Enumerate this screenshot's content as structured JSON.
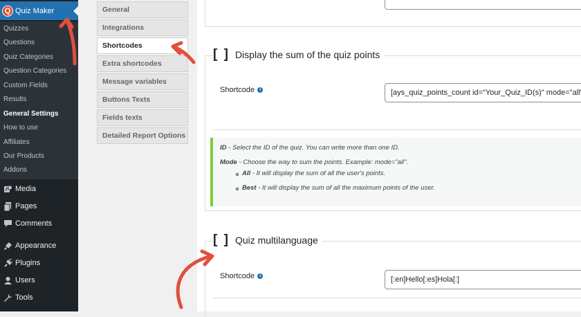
{
  "sidebar": {
    "plugin": {
      "label": "Quiz Maker",
      "icon": "quiz-maker-logo-icon"
    },
    "submenu": [
      {
        "label": "Quizzes"
      },
      {
        "label": "Questions"
      },
      {
        "label": "Quiz Categories"
      },
      {
        "label": "Question Categories"
      },
      {
        "label": "Custom Fields"
      },
      {
        "label": "Results"
      },
      {
        "label": "General Settings",
        "active": true
      },
      {
        "label": "How to use"
      },
      {
        "label": "Affiliates"
      },
      {
        "label": "Our Products"
      },
      {
        "label": "Addons"
      }
    ],
    "menu": [
      {
        "label": "Media",
        "icon": "media-icon"
      },
      {
        "label": "Pages",
        "icon": "pages-icon"
      },
      {
        "label": "Comments",
        "icon": "comments-icon"
      },
      {
        "label": "Appearance",
        "icon": "appearance-icon"
      },
      {
        "label": "Plugins",
        "icon": "plugins-icon"
      },
      {
        "label": "Users",
        "icon": "users-icon"
      },
      {
        "label": "Tools",
        "icon": "tools-icon"
      }
    ]
  },
  "tabs": [
    {
      "label": "General"
    },
    {
      "label": "Integrations"
    },
    {
      "label": "Shortcodes",
      "active": true
    },
    {
      "label": "Extra shortcodes"
    },
    {
      "label": "Message variables"
    },
    {
      "label": "Buttons Texts"
    },
    {
      "label": "Fields texts"
    },
    {
      "label": "Detailed Report Options"
    }
  ],
  "sections": [
    {
      "brackets": "[ ]",
      "title": "Display the sum of the quiz points",
      "field_label": "Shortcode",
      "value": "[ays_quiz_points_count id=\"Your_Quiz_ID(s)\" mode=\"all\"]",
      "notes": {
        "id_key": "ID",
        "id_text": " - Select the ID of the quiz. You can write more than one ID.",
        "mode_key": "Mode",
        "mode_text": " - Choose the way to sum the points. Example: mode=\"all\".",
        "all_key": "All",
        "all_text": " - It will display the sum of all the user's points.",
        "best_key": "Best",
        "best_text": " - It will display the sum of all the maximum points of the user."
      }
    },
    {
      "brackets": "[ ]",
      "title": "Quiz multilanguage",
      "field_label": "Shortcode",
      "value": "[:en]Hello[:es]Hola[:]"
    }
  ],
  "colors": {
    "sidebar_bg": "#1d2327",
    "submenu_bg": "#2c3338",
    "accent": "#2271b1",
    "annotation_arrow": "#e0503c",
    "note_border": "#7ad03a"
  }
}
